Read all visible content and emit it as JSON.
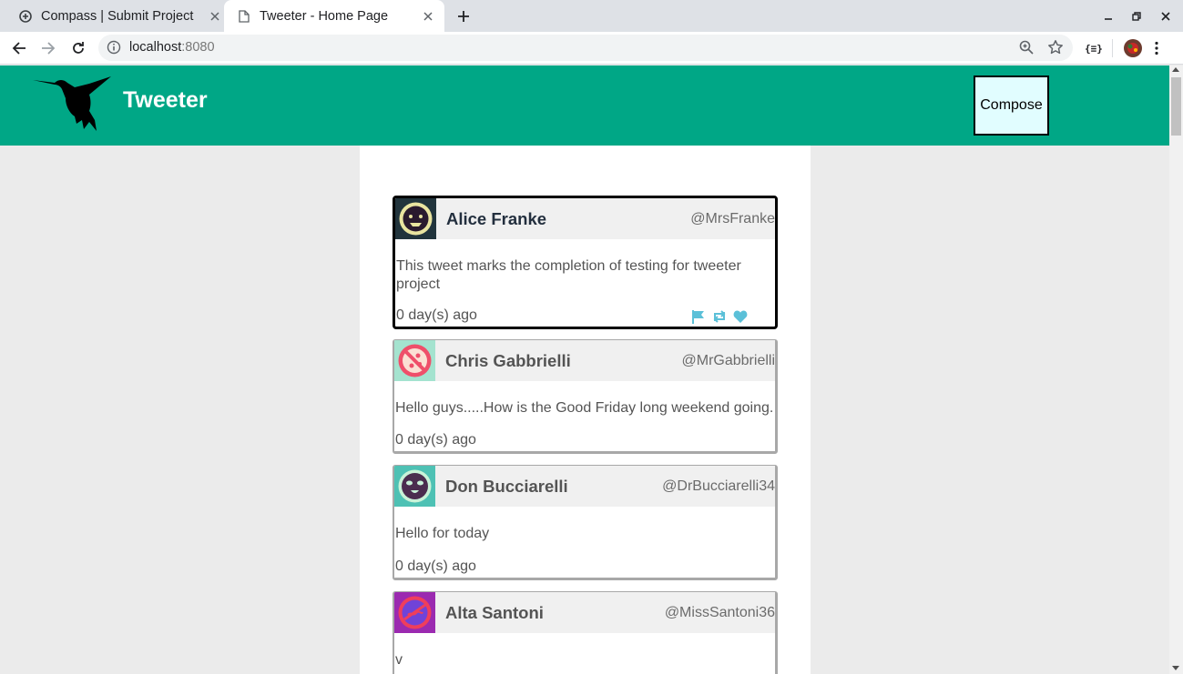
{
  "browser": {
    "tabs": [
      {
        "title": "Compass | Submit Project",
        "active": false
      },
      {
        "title": "Tweeter - Home Page",
        "active": true
      }
    ],
    "url_host": "localhost",
    "url_port": ":8080",
    "extension_label": "{≡}"
  },
  "app": {
    "brand": "Tweeter",
    "compose_label": "Compose",
    "colors": {
      "header": "#00a786",
      "compose_bg": "#e1fdff",
      "action_icons": "#5bc0d8"
    }
  },
  "tweets": [
    {
      "name": "Alice Franke",
      "handle": "@MrsFranke",
      "text": "This tweet marks the completion of testing for tweeter project",
      "age": "0 day(s) ago",
      "avatar": "smiley-face-avatar",
      "avatar_bg": "#21343c",
      "hovered": true
    },
    {
      "name": "Chris Gabbrielli",
      "handle": "@MrGabbrielli",
      "text": "Hello guys.....How is the Good Friday long weekend going.",
      "age": "0 day(s) ago",
      "avatar": "pizza-avatar",
      "avatar_bg": "#a4e3cf"
    },
    {
      "name": "Don Bucciarelli",
      "handle": "@DrBucciarelli34",
      "text": "Hello for today",
      "age": "0 day(s) ago",
      "avatar": "alien-face-avatar",
      "avatar_bg": "#4ec1b4"
    },
    {
      "name": "Alta Santoni",
      "handle": "@MissSantoni36",
      "text": "v",
      "age": "",
      "avatar": "wave-avatar",
      "avatar_bg": "#9b2ab0"
    }
  ]
}
